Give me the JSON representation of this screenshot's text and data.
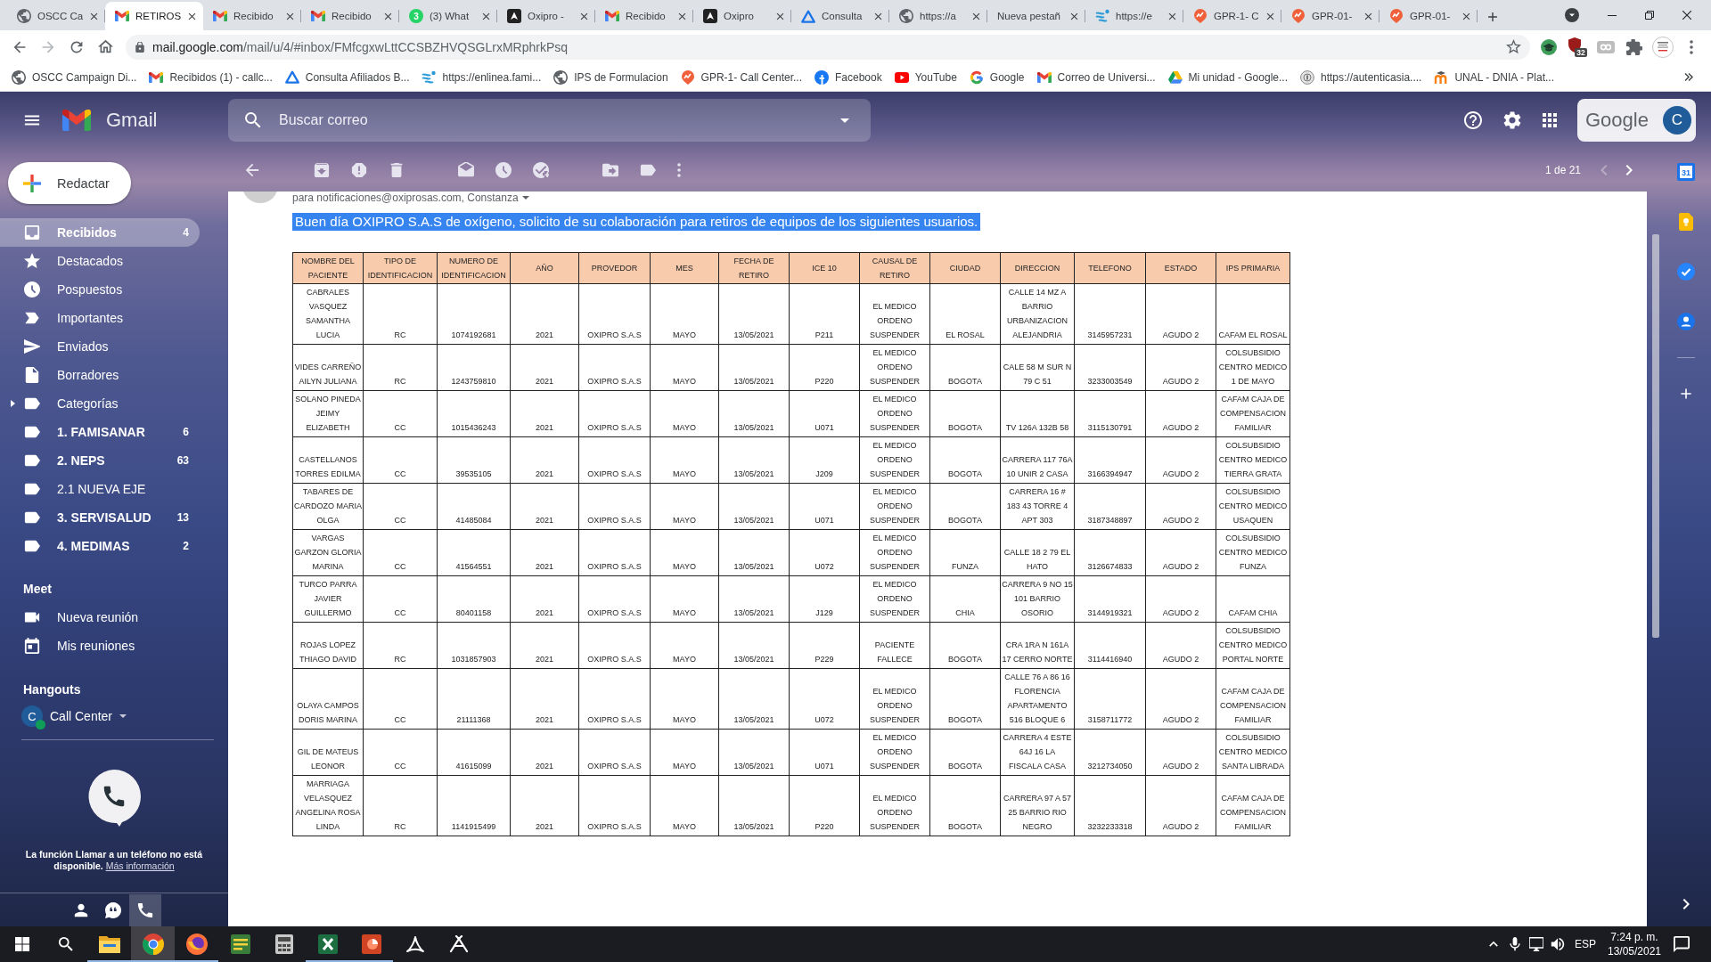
{
  "browser": {
    "tabs": [
      {
        "title": "OSCC Ca",
        "kind": "globe",
        "selected": false
      },
      {
        "title": "RETIROS",
        "kind": "gmail",
        "selected": true
      },
      {
        "title": "Recibido",
        "kind": "gmail",
        "selected": false
      },
      {
        "title": "Recibido",
        "kind": "gmail",
        "selected": false
      },
      {
        "title": "(3) What",
        "kind": "chat",
        "badge": "3",
        "selected": false
      },
      {
        "title": "Oxipro -",
        "kind": "app",
        "selected": false
      },
      {
        "title": "Recibido",
        "kind": "gmail",
        "selected": false
      },
      {
        "title": "Oxipro",
        "kind": "app",
        "selected": false
      },
      {
        "title": "Consulta",
        "kind": "triangle",
        "selected": false
      },
      {
        "title": "https://a",
        "kind": "globe",
        "selected": false
      },
      {
        "title": "Nueva pestañ",
        "kind": "none",
        "selected": false
      },
      {
        "title": "https://e",
        "kind": "wave",
        "selected": false
      },
      {
        "title": "GPR-1- C",
        "kind": "pin",
        "selected": false
      },
      {
        "title": "GPR-01-",
        "kind": "pin",
        "selected": false
      },
      {
        "title": "GPR-01-",
        "kind": "pin",
        "selected": false
      }
    ],
    "address": {
      "host": "mail.google.com",
      "path": "/mail/u/4/#inbox/FMfcgxwLttCCSBZHVQSGLrxMRphrkPsq"
    },
    "extensions": [
      {
        "kind": "cap"
      },
      {
        "kind": "shield",
        "badge": "32"
      },
      {
        "kind": "loop"
      },
      {
        "kind": "puzzle"
      },
      {
        "kind": "profile"
      }
    ],
    "bookmarks": [
      {
        "label": "OSCC Campaign Di...",
        "kind": "globe"
      },
      {
        "label": "Recibidos (1) - callc...",
        "kind": "gmail"
      },
      {
        "label": "Consulta Afiliados B...",
        "kind": "triangle"
      },
      {
        "label": "https://enlinea.fami...",
        "kind": "wave"
      },
      {
        "label": "IPS de Formulacion",
        "kind": "globe"
      },
      {
        "label": "GPR-1- Call Center...",
        "kind": "pin"
      },
      {
        "label": "Facebook",
        "kind": "round"
      },
      {
        "label": "YouTube",
        "kind": "play"
      },
      {
        "label": "Google",
        "kind": "ring"
      },
      {
        "label": "Correo de Universi...",
        "kind": "gmail"
      },
      {
        "label": "Mi unidad - Google...",
        "kind": "drive"
      },
      {
        "label": "https://autenticasia....",
        "kind": "seal"
      },
      {
        "label": "UNAL - DNIA - Plat...",
        "kind": "arches"
      }
    ]
  },
  "gmail": {
    "brand": "Gmail",
    "search": {
      "placeholder": "Buscar correo"
    },
    "account": {
      "label": "Google",
      "initial": "C"
    },
    "compose": "Redactar",
    "nav": [
      {
        "label": "Recibidos",
        "count": "4",
        "kind": "inbox",
        "selected": true,
        "unread": true
      },
      {
        "label": "Destacados",
        "kind": "star",
        "selected": false,
        "unread": false
      },
      {
        "label": "Pospuestos",
        "kind": "snooze",
        "selected": false,
        "unread": false
      },
      {
        "label": "Importantes",
        "kind": "important",
        "selected": false,
        "unread": false
      },
      {
        "label": "Enviados",
        "kind": "sent",
        "selected": false,
        "unread": false
      },
      {
        "label": "Borradores",
        "kind": "draft",
        "selected": false,
        "unread": false
      },
      {
        "label": "Categorías",
        "kind": "category",
        "expanded": false,
        "selected": false,
        "unread": false
      },
      {
        "label": "1. FAMISANAR",
        "count": "6",
        "kind": "label",
        "selected": false,
        "unread": true
      },
      {
        "label": "2. NEPS",
        "count": "63",
        "kind": "label",
        "selected": false,
        "unread": true
      },
      {
        "label": "2.1 NUEVA EJE",
        "kind": "label",
        "selected": false,
        "unread": false
      },
      {
        "label": "3. SERVISALUD",
        "count": "13",
        "kind": "label",
        "selected": false,
        "unread": true
      },
      {
        "label": "4. MEDIMAS",
        "count": "2",
        "kind": "label",
        "selected": false,
        "unread": true
      }
    ],
    "meet": {
      "title": "Meet",
      "items": [
        {
          "label": "Nueva reunión",
          "kind": "video"
        },
        {
          "label": "Mis reuniones",
          "kind": "calendar"
        }
      ]
    },
    "hangouts": {
      "title": "Hangouts",
      "user": {
        "initial": "C",
        "name": "Call Center",
        "online": true
      },
      "notice": "La función Llamar a un teléfono no está disponible.",
      "link": "Más información",
      "tabs": [
        {
          "kind": "person",
          "selected": false
        },
        {
          "kind": "chat",
          "selected": false
        },
        {
          "kind": "phone",
          "selected": true
        }
      ]
    },
    "pager": {
      "label": "1 de 21",
      "prev_disabled": true,
      "next_disabled": false
    },
    "side_panel": {
      "calendar_day": "31"
    },
    "message": {
      "recipients": "para notificaciones@oxiprosas.com, Constanza",
      "intro": {
        "text": "Buen día OXIPRO S.A.S de oxígeno, solicito de su colaboración para retiros de equipos de los siguientes usuarios.",
        "highlighted": true
      },
      "table": {
        "columns": [
          "NOMBRE DEL PACIENTE",
          "TIPO DE IDENTIFICACION",
          "NUMERO DE IDENTIFICACION",
          "AÑO",
          "PROVEDOR",
          "MES",
          "FECHA DE RETIRO",
          "ICE 10",
          "CAUSAL DE RETIRO",
          "CIUDAD",
          "DIRECCION",
          "TELEFONO",
          "ESTADO",
          "IPS PRIMARIA"
        ],
        "rows": [
          [
            "CABRALES VASQUEZ SAMANTHA LUCIA",
            "RC",
            "1074192681",
            "2021",
            "OXIPRO S.A.S",
            "MAYO",
            "13/05/2021",
            "P211",
            "EL MEDICO ORDENO SUSPENDER",
            "EL ROSAL",
            "CALLE 14 MZ A BARRIO URBANIZACION ALEJANDRIA",
            "3145957231",
            "AGUDO 2",
            "CAFAM EL ROSAL"
          ],
          [
            "VIDES CARREÑO AILYN JULIANA",
            "RC",
            "1243759810",
            "2021",
            "OXIPRO S.A.S",
            "MAYO",
            "13/05/2021",
            "P220",
            "EL MEDICO ORDENO SUSPENDER",
            "BOGOTA",
            "CALE 58 M SUR N 79 C 51",
            "3233003549",
            "AGUDO 2",
            "COLSUBSIDIO CENTRO MEDICO 1 DE MAYO"
          ],
          [
            "SOLANO PINEDA JEIMY ELIZABETH",
            "CC",
            "1015436243",
            "2021",
            "OXIPRO S.A.S",
            "MAYO",
            "13/05/2021",
            "U071",
            "EL MEDICO ORDENO SUSPENDER",
            "BOGOTA",
            "TV 126A 132B 58",
            "3115130791",
            "AGUDO 2",
            "CAFAM CAJA DE COMPENSACION FAMILIAR"
          ],
          [
            "CASTELLANOS TORRES EDILMA",
            "CC",
            "39535105",
            "2021",
            "OXIPRO S.A.S",
            "MAYO",
            "13/05/2021",
            "J209",
            "EL MEDICO ORDENO SUSPENDER",
            "BOGOTA",
            "CARRERA 117 76A 10 UNIR 2 CASA",
            "3166394947",
            "AGUDO 2",
            "COLSUBSIDIO CENTRO MEDICO TIERRA GRATA"
          ],
          [
            "TABARES DE CARDOZO MARIA OLGA",
            "CC",
            "41485084",
            "2021",
            "OXIPRO S.A.S",
            "MAYO",
            "13/05/2021",
            "U071",
            "EL MEDICO ORDENO SUSPENDER",
            "BOGOTA",
            "CARRERA 16 # 183 43 TORRE 4 APT 303",
            "3187348897",
            "AGUDO 2",
            "COLSUBSIDIO CENTRO MEDICO USAQUEN"
          ],
          [
            "VARGAS GARZON GLORIA MARINA",
            "CC",
            "41564551",
            "2021",
            "OXIPRO S.A.S",
            "MAYO",
            "13/05/2021",
            "U072",
            "EL MEDICO ORDENO SUSPENDER",
            "FUNZA",
            "CALLE 18 2 79 EL HATO",
            "3126674833",
            "AGUDO 2",
            "COLSUBSIDIO CENTRO MEDICO FUNZA"
          ],
          [
            "TURCO PARRA JAVIER GUILLERMO",
            "CC",
            "80401158",
            "2021",
            "OXIPRO S.A.S",
            "MAYO",
            "13/05/2021",
            "J129",
            "EL MEDICO ORDENO SUSPENDER",
            "CHIA",
            "CARRERA 9 NO 15 101 BARRIO OSORIO",
            "3144919321",
            "AGUDO 2",
            "CAFAM CHIA"
          ],
          [
            "ROJAS LOPEZ THIAGO DAVID",
            "RC",
            "1031857903",
            "2021",
            "OXIPRO S.A.S",
            "MAYO",
            "13/05/2021",
            "P229",
            "PACIENTE FALLECE",
            "BOGOTA",
            "CRA 1RA N 161A 17 CERRO NORTE",
            "3114416940",
            "AGUDO 2",
            "COLSUBSIDIO CENTRO MEDICO PORTAL NORTE"
          ],
          [
            "OLAYA CAMPOS DORIS MARINA",
            "CC",
            "21111368",
            "2021",
            "OXIPRO S.A.S",
            "MAYO",
            "13/05/2021",
            "U072",
            "EL MEDICO ORDENO SUSPENDER",
            "BOGOTA",
            "CALLE 76 A 86 16 FLORENCIA APARTAMENTO 516 BLOQUE 6",
            "3158711772",
            "AGUDO 2",
            "CAFAM CAJA DE COMPENSACION FAMILIAR"
          ],
          [
            "GIL DE MATEUS LEONOR",
            "CC",
            "41615099",
            "2021",
            "OXIPRO S.A.S",
            "MAYO",
            "13/05/2021",
            "U071",
            "EL MEDICO ORDENO SUSPENDER",
            "BOGOTA",
            "CARRERA 4 ESTE 64J 16 LA FISCALA CASA",
            "3212734050",
            "AGUDO 2",
            "COLSUBSIDIO CENTRO MEDICO SANTA LIBRADA"
          ],
          [
            "MARRIAGA VELASQUEZ ANGELINA ROSA LINDA",
            "RC",
            "1141915499",
            "2021",
            "OXIPRO S.A.S",
            "MAYO",
            "13/05/2021",
            "P220",
            "EL MEDICO ORDENO SUSPENDER",
            "BOGOTA",
            "CARRERA 97 A 57 25 BARRIO RIO NEGRO",
            "3232233318",
            "AGUDO 2",
            "CAFAM CAJA DE COMPENSACION FAMILIAR"
          ]
        ]
      }
    }
  },
  "taskbar": {
    "apps": [
      {
        "kind": "folder",
        "running": true,
        "selected": false
      },
      {
        "kind": "browser",
        "running": true,
        "selected": true
      },
      {
        "kind": "fox",
        "running": true,
        "selected": false
      },
      {
        "kind": "notes",
        "running": false,
        "selected": false
      },
      {
        "kind": "calculator",
        "running": false,
        "selected": false
      },
      {
        "kind": "sheet",
        "running": true,
        "selected": false
      },
      {
        "kind": "slides",
        "running": true,
        "selected": false
      },
      {
        "kind": "reader",
        "running": false,
        "selected": false
      },
      {
        "kind": "tool",
        "running": false,
        "selected": false
      }
    ],
    "language": "ESP",
    "time": "7:24 p. m.",
    "date": "13/05/2021"
  }
}
